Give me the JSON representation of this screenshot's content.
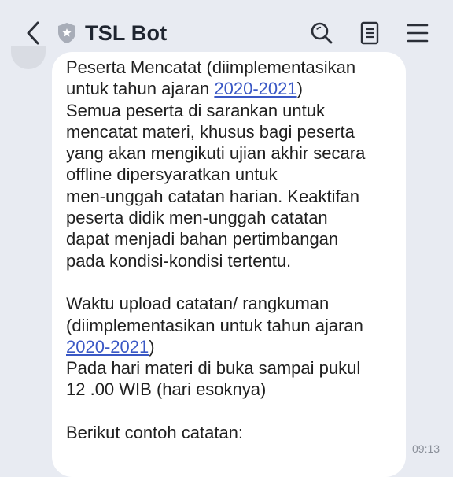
{
  "header": {
    "title": "TSL Bot"
  },
  "message": {
    "lines": {
      "l0": "Peserta Mencatat (diimplementasikan",
      "l1_pre": "untuk tahun ajaran ",
      "l1_link": "2020-2021",
      "l1_post": ")",
      "l2": "Semua peserta di sarankan untuk",
      "l3": "mencatat materi, khusus bagi peserta",
      "l4": "yang akan mengikuti ujian akhir secara",
      "l5": "offline dipersyaratkan untuk",
      "l6": "men-unggah catatan harian. Keaktifan",
      "l7": "peserta didik men-unggah catatan",
      "l8": "dapat menjadi bahan pertimbangan",
      "l9": "pada kondisi-kondisi tertentu.",
      "l10": "Waktu upload catatan/ rangkuman",
      "l11": "(diimplementasikan untuk tahun ajaran",
      "l12_link": "2020-2021",
      "l12_post": ")",
      "l13": "Pada hari materi di buka sampai pukul",
      "l14": "12 .00 WIB (hari esoknya)",
      "l15": "Berikut contoh catatan:"
    },
    "time": "09:13"
  },
  "icons": {
    "back": "chevron-left-icon",
    "shield": "shield-icon",
    "search": "search-icon",
    "notes": "notes-icon",
    "menu": "hamburger-menu-icon"
  },
  "colors": {
    "background": "#e8ebf2",
    "bubble": "#ffffff",
    "link": "#3a58c5",
    "text": "#202020",
    "time": "#8a8f99"
  }
}
